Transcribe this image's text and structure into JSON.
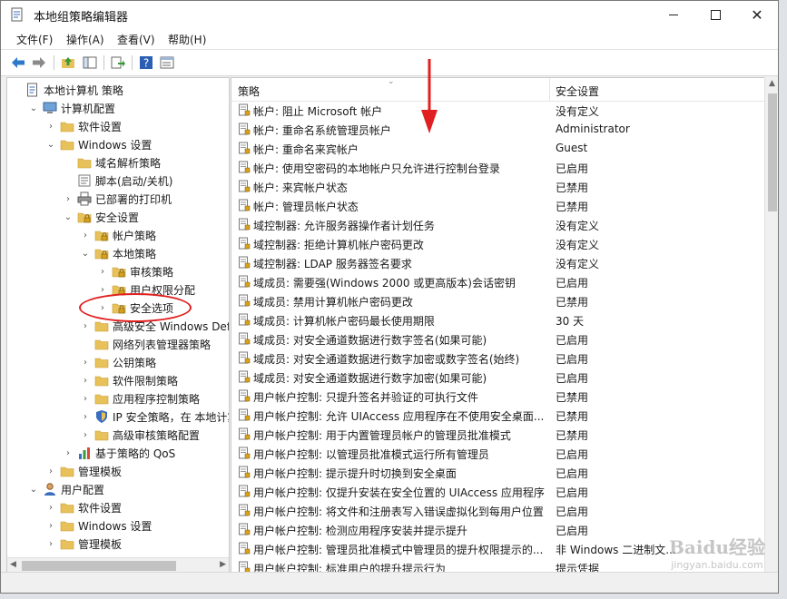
{
  "window": {
    "title": "本地组策略编辑器"
  },
  "menu": [
    "文件(F)",
    "操作(A)",
    "查看(V)",
    "帮助(H)"
  ],
  "tree": [
    {
      "label": "本地计算机 策略",
      "indent": 0,
      "expander": "",
      "icon": "policy-doc"
    },
    {
      "label": "计算机配置",
      "indent": 1,
      "expander": "⌄",
      "icon": "computer"
    },
    {
      "label": "软件设置",
      "indent": 2,
      "expander": "›",
      "icon": "folder"
    },
    {
      "label": "Windows 设置",
      "indent": 2,
      "expander": "⌄",
      "icon": "folder"
    },
    {
      "label": "域名解析策略",
      "indent": 3,
      "expander": "",
      "icon": "folder"
    },
    {
      "label": "脚本(启动/关机)",
      "indent": 3,
      "expander": "",
      "icon": "script"
    },
    {
      "label": "已部署的打印机",
      "indent": 3,
      "expander": "›",
      "icon": "printer"
    },
    {
      "label": "安全设置",
      "indent": 3,
      "expander": "⌄",
      "icon": "folder-lock"
    },
    {
      "label": "帐户策略",
      "indent": 4,
      "expander": "›",
      "icon": "folder-lock"
    },
    {
      "label": "本地策略",
      "indent": 4,
      "expander": "⌄",
      "icon": "folder-lock"
    },
    {
      "label": "审核策略",
      "indent": 5,
      "expander": "›",
      "icon": "folder-lock"
    },
    {
      "label": "用户权限分配",
      "indent": 5,
      "expander": "›",
      "icon": "folder-lock"
    },
    {
      "label": "安全选项",
      "indent": 5,
      "expander": "›",
      "icon": "folder-lock"
    },
    {
      "label": "高级安全 Windows Defe",
      "indent": 4,
      "expander": "›",
      "icon": "folder"
    },
    {
      "label": "网络列表管理器策略",
      "indent": 4,
      "expander": "",
      "icon": "folder"
    },
    {
      "label": "公钥策略",
      "indent": 4,
      "expander": "›",
      "icon": "folder"
    },
    {
      "label": "软件限制策略",
      "indent": 4,
      "expander": "›",
      "icon": "folder"
    },
    {
      "label": "应用程序控制策略",
      "indent": 4,
      "expander": "›",
      "icon": "folder"
    },
    {
      "label": "IP 安全策略，在 本地计算",
      "indent": 4,
      "expander": "›",
      "icon": "shield"
    },
    {
      "label": "高级审核策略配置",
      "indent": 4,
      "expander": "›",
      "icon": "folder"
    },
    {
      "label": "基于策略的 QoS",
      "indent": 3,
      "expander": "›",
      "icon": "chart"
    },
    {
      "label": "管理模板",
      "indent": 2,
      "expander": "›",
      "icon": "folder"
    },
    {
      "label": "用户配置",
      "indent": 1,
      "expander": "⌄",
      "icon": "user"
    },
    {
      "label": "软件设置",
      "indent": 2,
      "expander": "›",
      "icon": "folder"
    },
    {
      "label": "Windows 设置",
      "indent": 2,
      "expander": "›",
      "icon": "folder"
    },
    {
      "label": "管理模板",
      "indent": 2,
      "expander": "›",
      "icon": "folder"
    }
  ],
  "list": {
    "columns": [
      "策略",
      "安全设置"
    ],
    "rows": [
      {
        "name": "帐户: 阻止 Microsoft 帐户",
        "value": "没有定义"
      },
      {
        "name": "帐户: 重命名系统管理员帐户",
        "value": "Administrator"
      },
      {
        "name": "帐户: 重命名来宾帐户",
        "value": "Guest"
      },
      {
        "name": "帐户: 使用空密码的本地帐户只允许进行控制台登录",
        "value": "已启用"
      },
      {
        "name": "帐户: 来宾帐户状态",
        "value": "已禁用"
      },
      {
        "name": "帐户: 管理员帐户状态",
        "value": "已禁用"
      },
      {
        "name": "域控制器: 允许服务器操作者计划任务",
        "value": "没有定义"
      },
      {
        "name": "域控制器: 拒绝计算机帐户密码更改",
        "value": "没有定义"
      },
      {
        "name": "域控制器: LDAP 服务器签名要求",
        "value": "没有定义"
      },
      {
        "name": "域成员: 需要强(Windows 2000 或更高版本)会话密钥",
        "value": "已启用"
      },
      {
        "name": "域成员: 禁用计算机帐户密码更改",
        "value": "已禁用"
      },
      {
        "name": "域成员: 计算机帐户密码最长使用期限",
        "value": "30 天"
      },
      {
        "name": "域成员: 对安全通道数据进行数字签名(如果可能)",
        "value": "已启用"
      },
      {
        "name": "域成员: 对安全通道数据进行数字加密或数字签名(始终)",
        "value": "已启用"
      },
      {
        "name": "域成员: 对安全通道数据进行数字加密(如果可能)",
        "value": "已启用"
      },
      {
        "name": "用户帐户控制: 只提升签名并验证的可执行文件",
        "value": "已禁用"
      },
      {
        "name": "用户帐户控制: 允许 UIAccess 应用程序在不使用安全桌面...",
        "value": "已禁用"
      },
      {
        "name": "用户帐户控制: 用于内置管理员帐户的管理员批准模式",
        "value": "已禁用"
      },
      {
        "name": "用户帐户控制: 以管理员批准模式运行所有管理员",
        "value": "已启用"
      },
      {
        "name": "用户帐户控制: 提示提升时切换到安全桌面",
        "value": "已启用"
      },
      {
        "name": "用户帐户控制: 仅提升安装在安全位置的 UIAccess 应用程序",
        "value": "已启用"
      },
      {
        "name": "用户帐户控制: 将文件和注册表写入错误虚拟化到每用户位置",
        "value": "已启用"
      },
      {
        "name": "用户帐户控制: 检测应用程序安装并提示提升",
        "value": "已启用"
      },
      {
        "name": "用户帐户控制: 管理员批准模式中管理员的提升权限提示的...",
        "value": "非 Windows 二进制文..."
      },
      {
        "name": "用户帐户控制: 标准用户的提升提示行为",
        "value": "提示凭据"
      }
    ]
  },
  "watermark": {
    "logo": "Baidu经验",
    "url": "jingyan.baidu.com"
  },
  "colors": {
    "annotation": "#e02020",
    "folder": "#e8c15a"
  }
}
